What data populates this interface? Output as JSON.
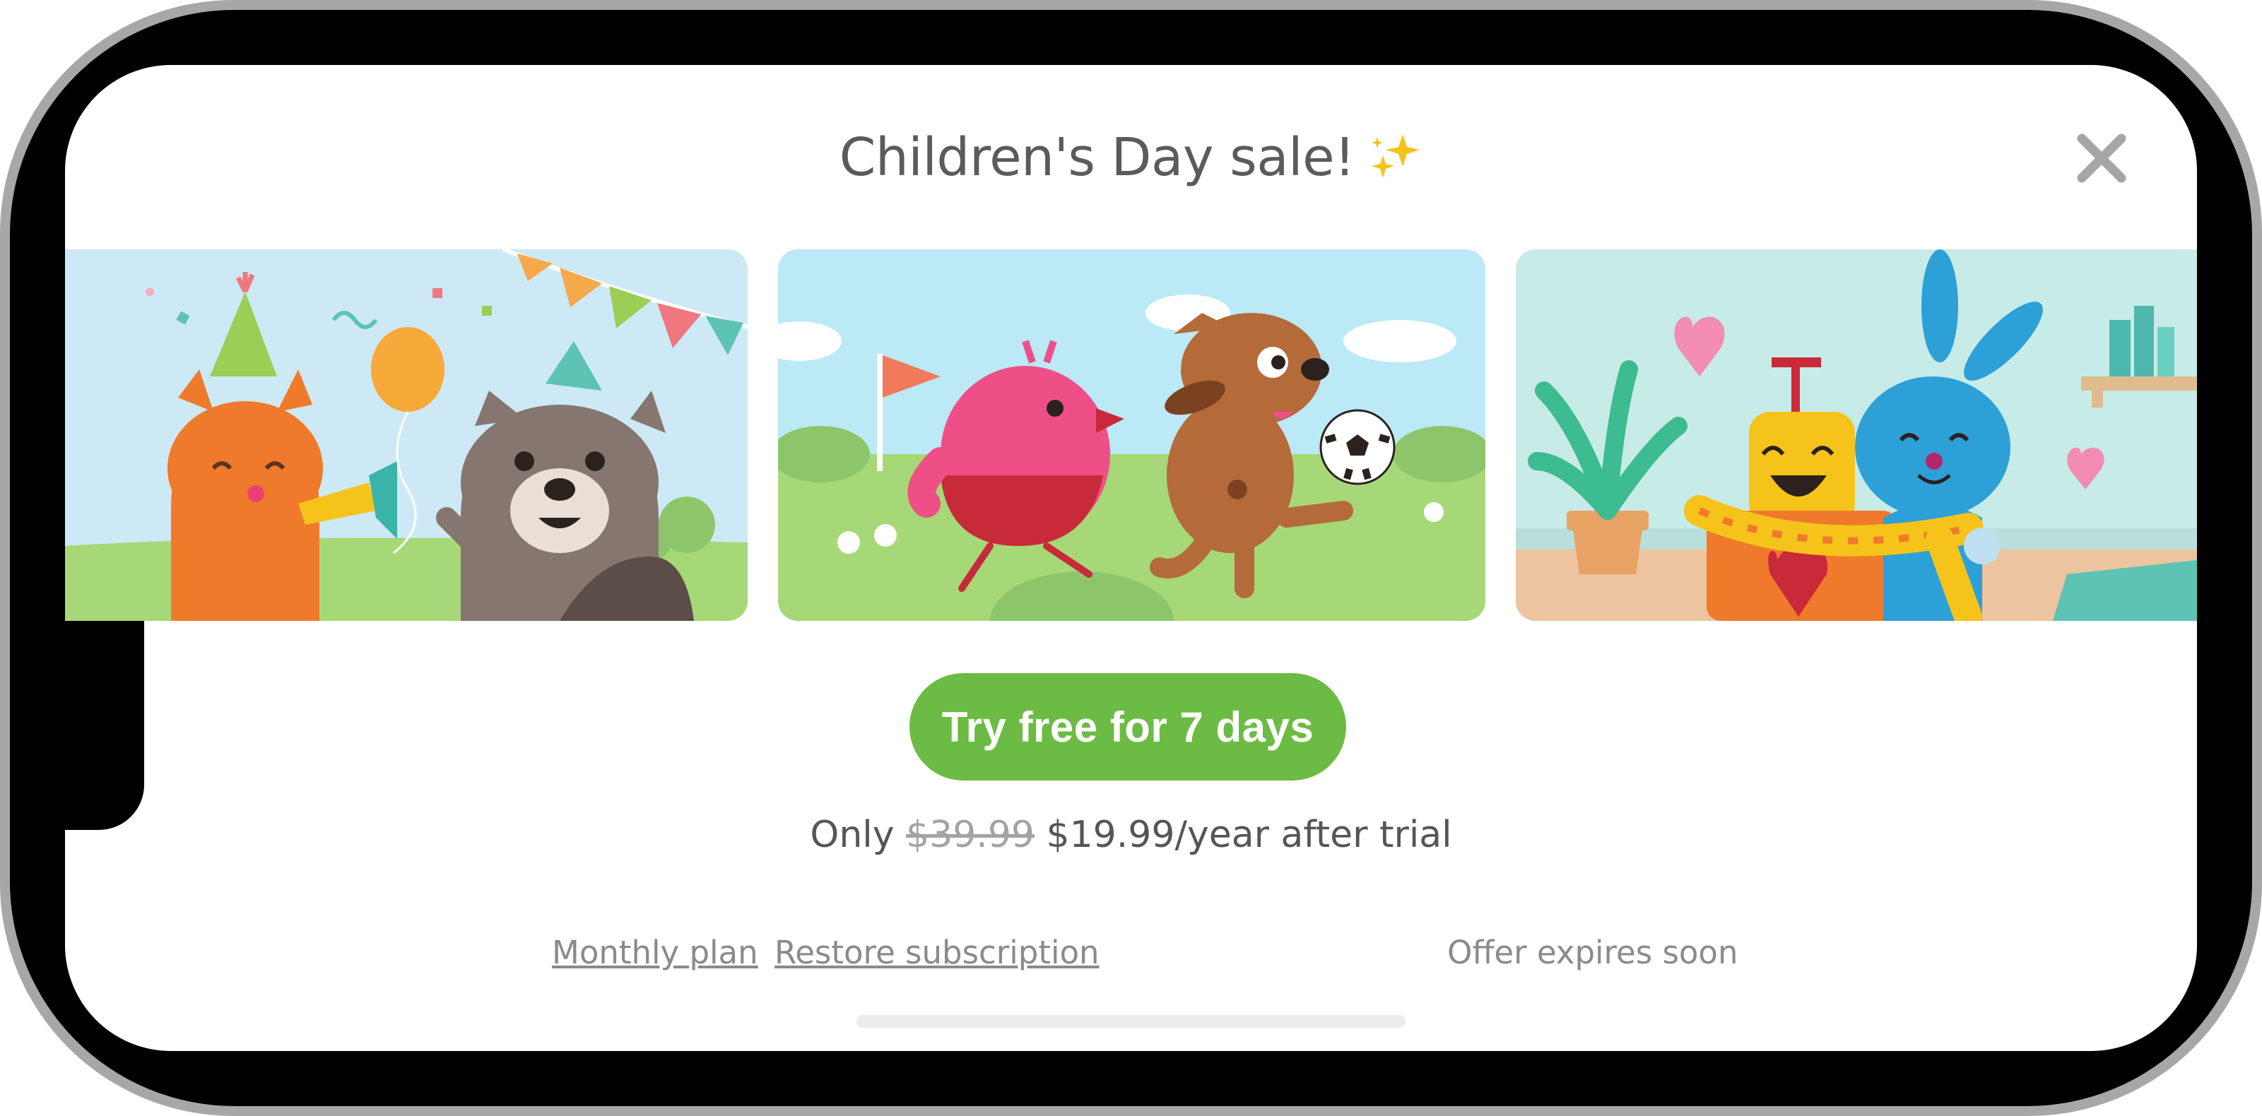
{
  "modal": {
    "title": "Children's Day sale!",
    "title_icon": "sparkles-icon",
    "close_icon": "close-icon"
  },
  "carousel": {
    "panels": [
      {
        "scene": "party",
        "bg": "#cde9f5"
      },
      {
        "scene": "soccer",
        "bg": "#bbe9f6"
      },
      {
        "scene": "hug",
        "bg": "#c7ebe6"
      }
    ]
  },
  "cta": {
    "label": "Try free for 7 days",
    "color": "#6cbb44"
  },
  "pricing": {
    "prefix": "Only",
    "old_price": "$39.99",
    "new_price": "$19.99/year after trial"
  },
  "footer": {
    "monthly_plan": "Monthly plan",
    "restore": "Restore subscription",
    "expires": "Offer expires soon"
  }
}
